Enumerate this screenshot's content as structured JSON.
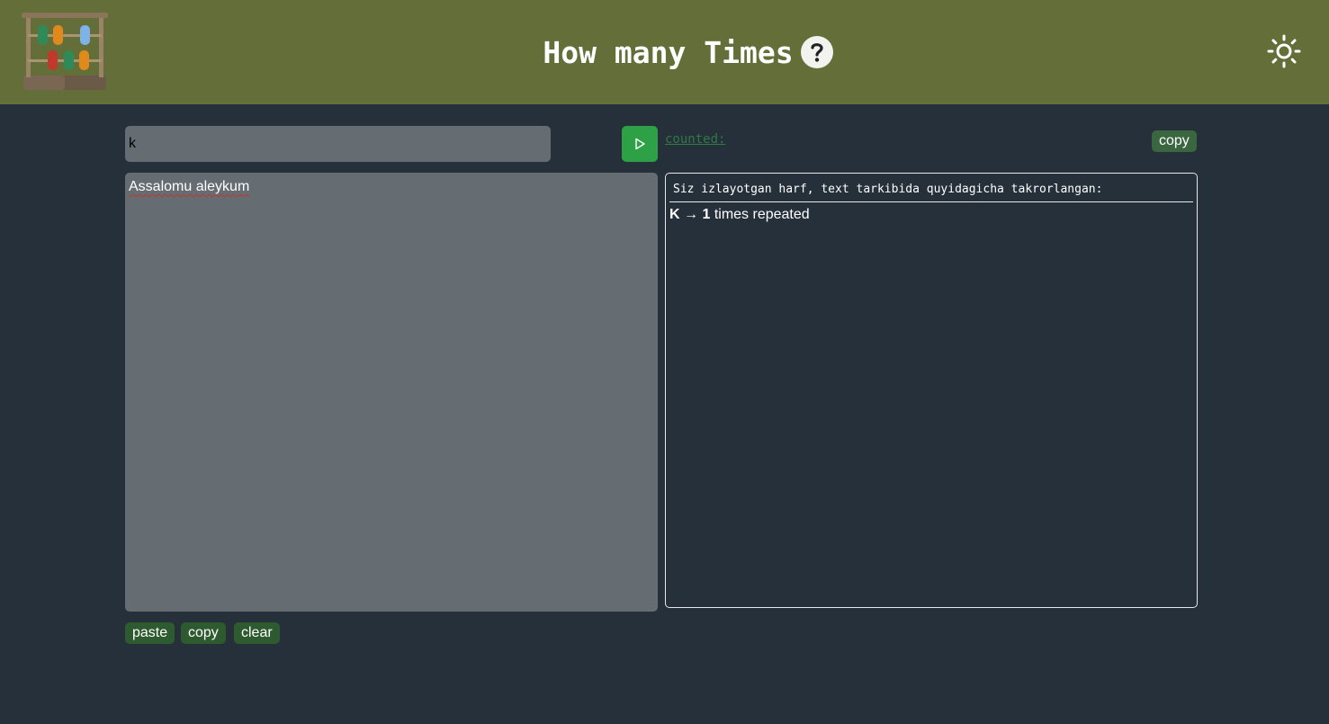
{
  "header": {
    "title": "How many Times",
    "logo_icon": "abacus-icon",
    "help_icon": "question-mark-icon",
    "theme_icon": "sun-icon"
  },
  "search": {
    "value": "k",
    "placeholder": ""
  },
  "run_icon": "play-icon",
  "counted_label": "counted:",
  "result_copy_label": "copy",
  "textarea": {
    "value": "Assalomu aleykum"
  },
  "result": {
    "heading": "Siz izlayotgan harf, text tarkibida quyidagicha takrorlangan:",
    "items": [
      {
        "letter": "K",
        "arrow": "→",
        "count": "1",
        "suffix": "times repeated"
      }
    ]
  },
  "actions": {
    "paste_label": "paste",
    "copy_label": "copy",
    "clear_label": "clear"
  },
  "colors": {
    "header_bg": "#636e38",
    "page_bg": "#25303a",
    "input_bg": "#656c72",
    "run_button": "#2ea045",
    "small_button": "#2d5a2e"
  }
}
